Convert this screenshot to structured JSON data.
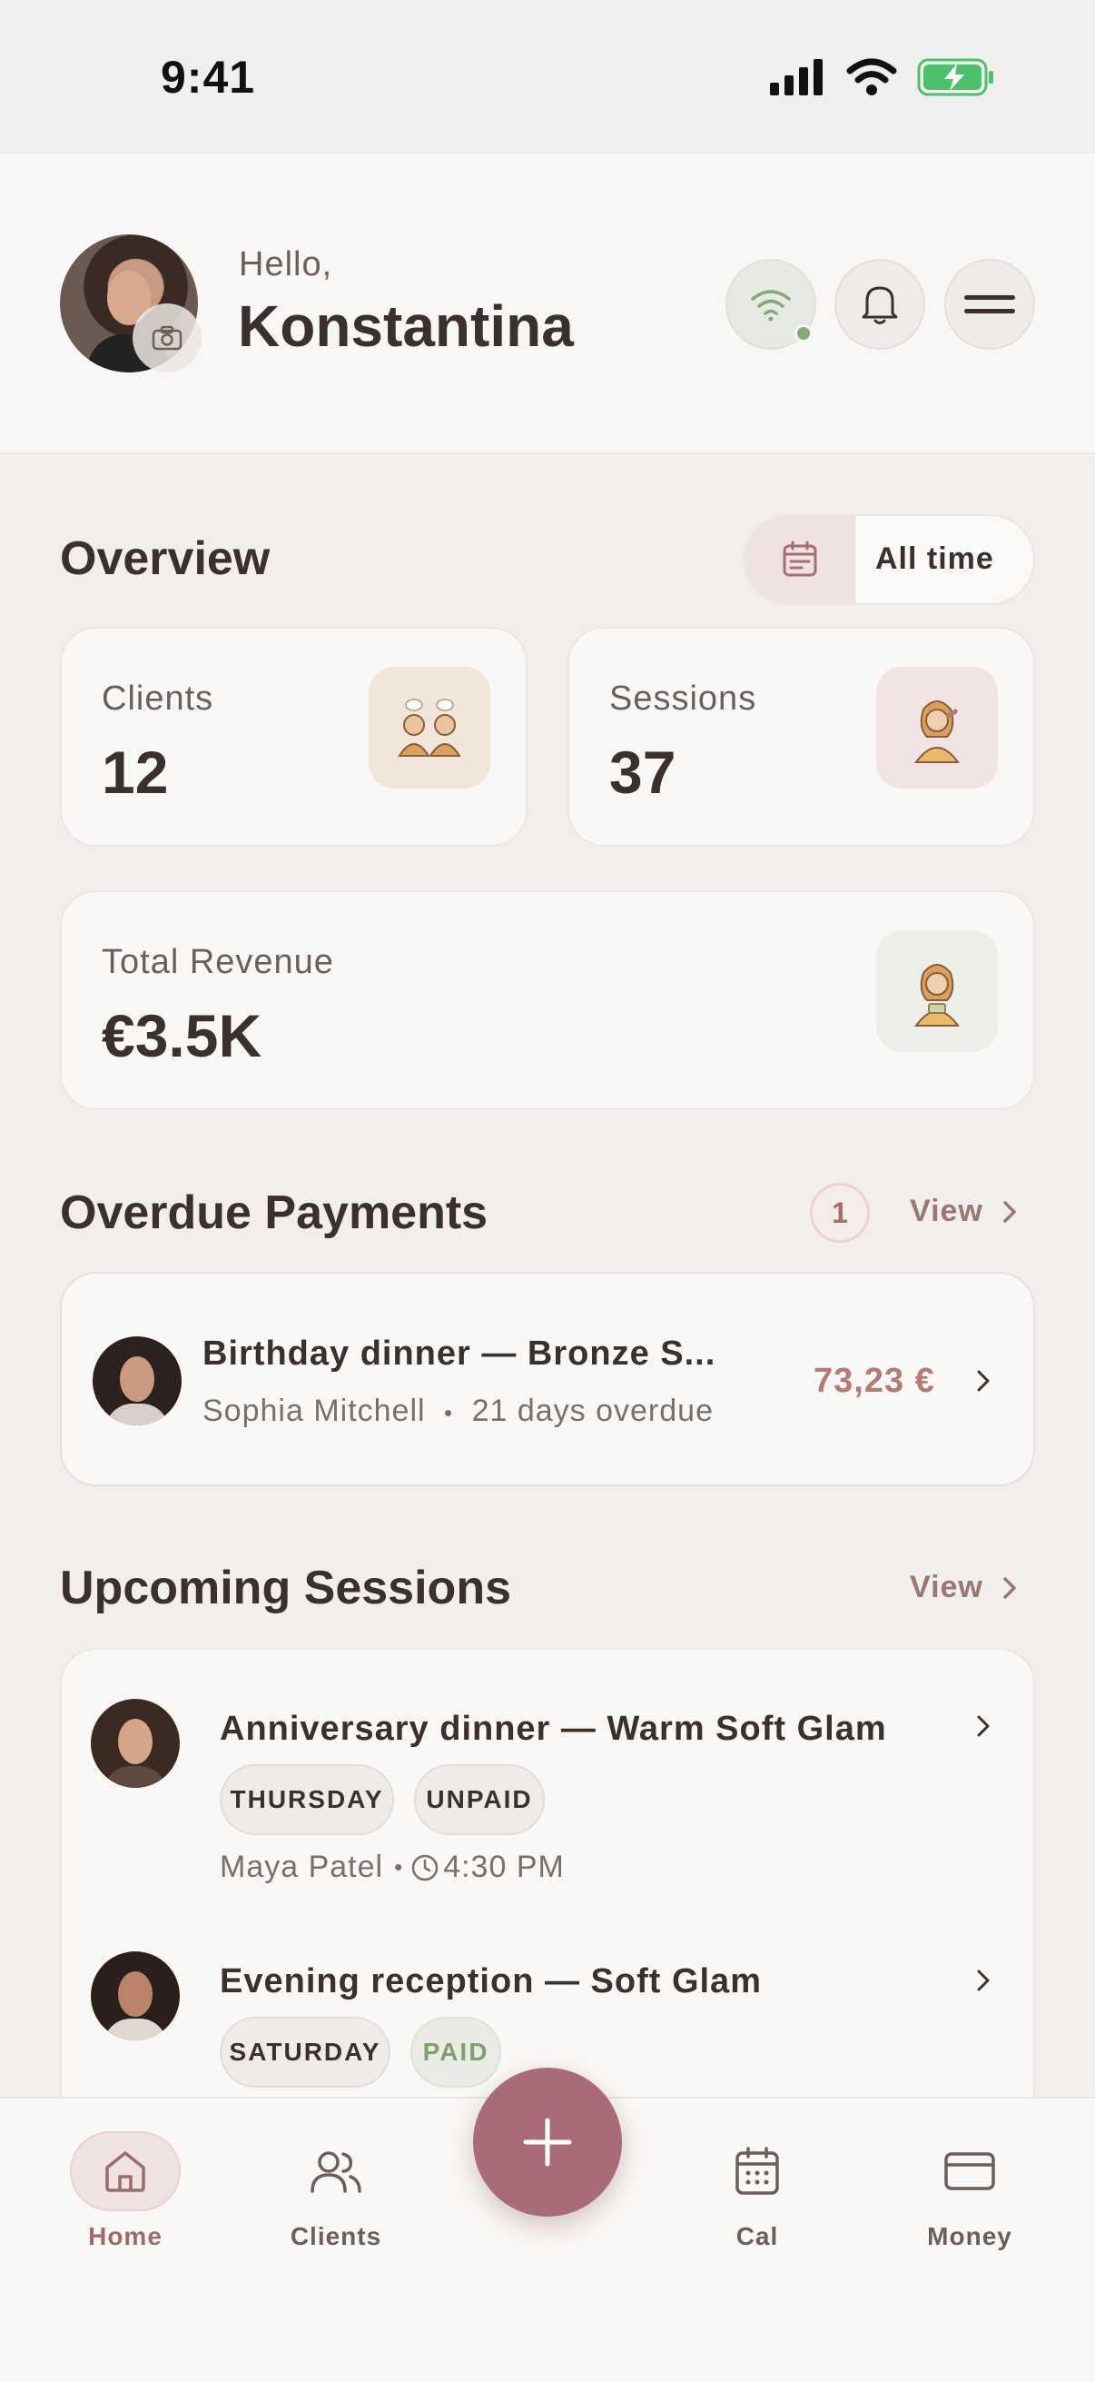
{
  "status_bar": {
    "time": "9:41"
  },
  "header": {
    "greeting": "Hello,",
    "name": "Konstantina"
  },
  "overview": {
    "title": "Overview",
    "range": "All time",
    "stats": {
      "clients": {
        "label": "Clients",
        "value": "12"
      },
      "sessions": {
        "label": "Sessions",
        "value": "37"
      },
      "revenue": {
        "label": "Total Revenue",
        "value": "€3.5K"
      }
    }
  },
  "overdue": {
    "title": "Overdue Payments",
    "count": "1",
    "view_label": "View",
    "items": [
      {
        "title": "Birthday dinner — Bronze S...",
        "client": "Sophia Mitchell",
        "detail": "21 days overdue",
        "amount": "73,23 €"
      }
    ]
  },
  "upcoming": {
    "title": "Upcoming Sessions",
    "view_label": "View",
    "items": [
      {
        "title": "Anniversary dinner — Warm Soft Glam",
        "day": "THURSDAY",
        "payment": "UNPAID",
        "client": "Maya Patel",
        "time": "4:30 PM"
      },
      {
        "title": "Evening reception — Soft Glam",
        "day": "SATURDAY",
        "payment": "PAID"
      }
    ]
  },
  "nav": {
    "items": [
      {
        "label": "Home",
        "icon": "home-icon",
        "active": true
      },
      {
        "label": "Clients",
        "icon": "users-icon"
      },
      {
        "label": "Cal",
        "icon": "calendar-icon"
      },
      {
        "label": "Money",
        "icon": "card-icon"
      }
    ],
    "fab_icon": "plus-icon"
  },
  "colors": {
    "accent": "#a86c77",
    "overdue_amount": "#b57a73",
    "paid": "#7fa172",
    "background": "#f1eeeb"
  }
}
